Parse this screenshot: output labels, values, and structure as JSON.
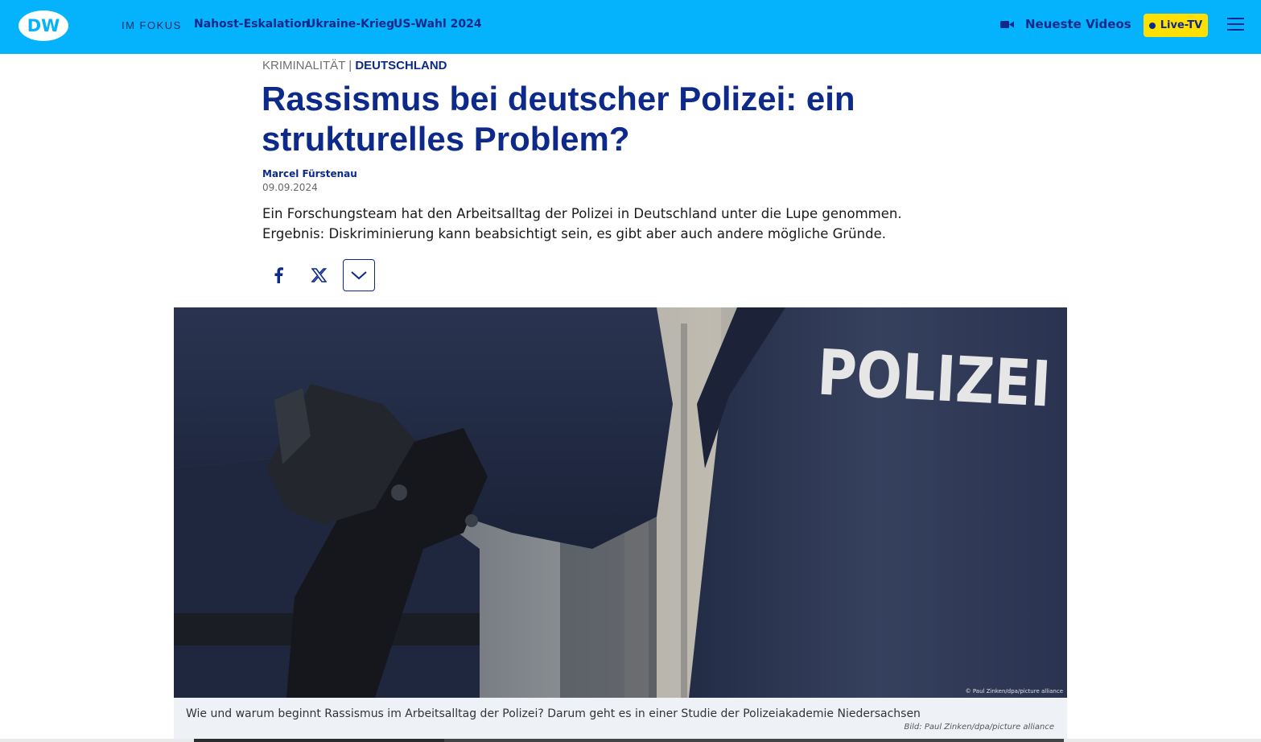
{
  "header": {
    "logo_text": "DW",
    "focus_label": "IM FOKUS",
    "topics": [
      "Nahost-Eskalation",
      "Ukraine-Krieg",
      "US-Wahl 2024"
    ],
    "videos_label": "Neueste Videos",
    "live_label": "Live-TV"
  },
  "article": {
    "category": "KRIMINALITÄT",
    "separator": "|",
    "region": "DEUTSCHLAND",
    "headline": "Rassismus bei deutscher Polizei: ein strukturelles Problem?",
    "author": "Marcel Fürstenau",
    "date": "09.09.2024",
    "teaser": "Ein Forschungsteam hat den Arbeitsalltag der Polizei in Deutschland unter die Lupe genommen. Ergebnis: Diskriminierung kann beabsichtigt sein, es gibt aber auch andere mögliche Gründe."
  },
  "image": {
    "jacket_text": "POLIZEI",
    "watermark": "© Paul Zinken/dpa/picture alliance",
    "caption": "Wie und warum beginnt Rassismus im Arbeitsalltag der Polizei? Darum geht es in einer Studie der Polizeiakademie Niedersachsen",
    "credit": "Bild: Paul Zinken/dpa/picture alliance"
  },
  "colors": {
    "header_bg": "#05b2fc",
    "brand_navy": "#0d2a8a",
    "live_yellow": "#ffe000"
  }
}
